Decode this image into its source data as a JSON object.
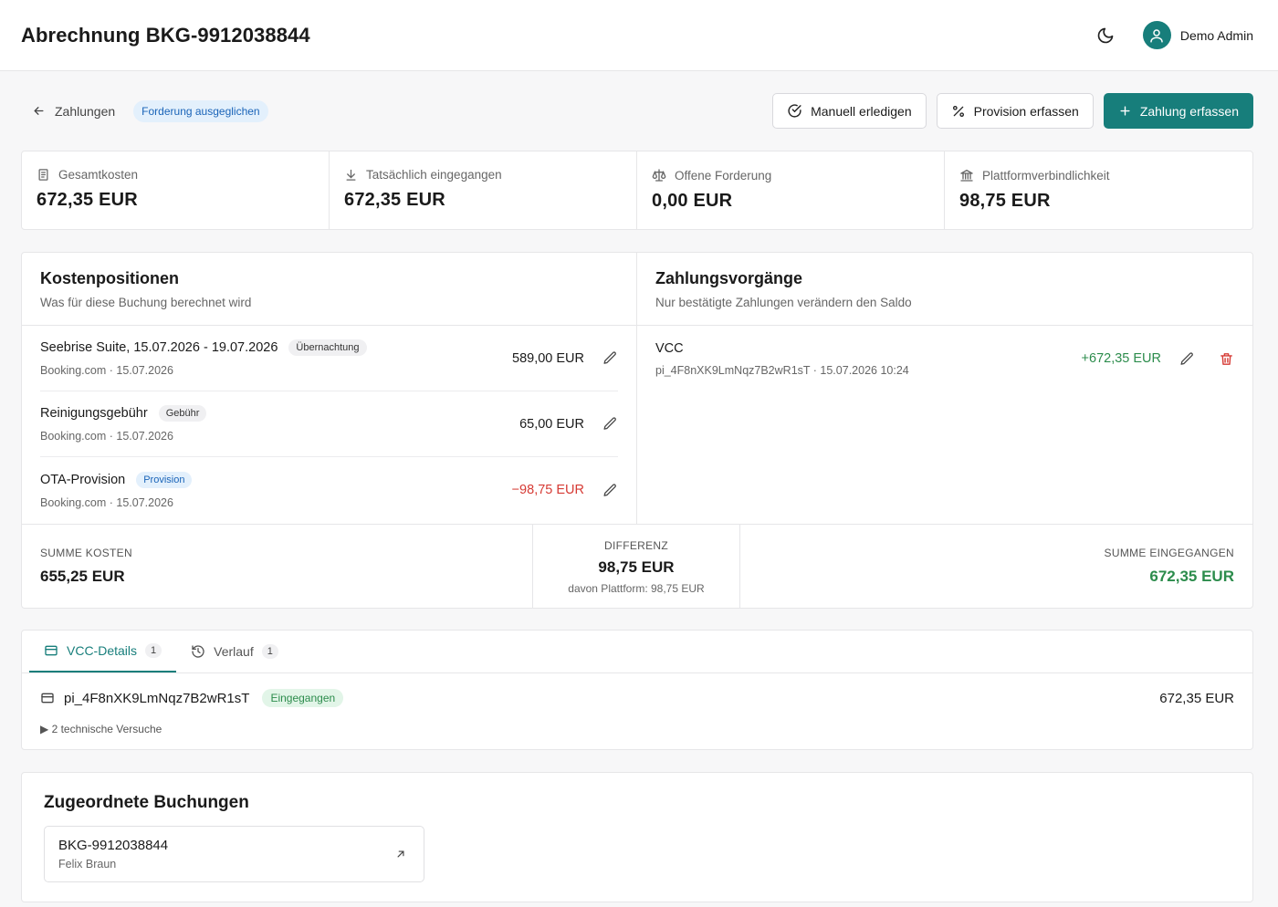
{
  "header": {
    "title": "Abrechnung BKG-9912038844",
    "user_name": "Demo Admin"
  },
  "toolbar": {
    "back_label": "Zahlungen",
    "status_badge": "Forderung ausgeglichen",
    "manual_label": "Manuell erledigen",
    "commission_label": "Provision erfassen",
    "payment_label": "Zahlung erfassen"
  },
  "stats": [
    {
      "label": "Gesamtkosten",
      "value": "672,35 EUR"
    },
    {
      "label": "Tatsächlich eingegangen",
      "value": "672,35 EUR"
    },
    {
      "label": "Offene Forderung",
      "value": "0,00 EUR"
    },
    {
      "label": "Plattformverbindlichkeit",
      "value": "98,75 EUR"
    }
  ],
  "costs": {
    "title": "Kostenpositionen",
    "subtitle": "Was für diese Buchung berechnet wird",
    "items": [
      {
        "name": "Seebrise Suite, 15.07.2026 - 19.07.2026",
        "tag": "Übernachtung",
        "meta": "Booking.com · 15.07.2026",
        "amount": "589,00 EUR"
      },
      {
        "name": "Reinigungsgebühr",
        "tag": "Gebühr",
        "meta": "Booking.com · 15.07.2026",
        "amount": "65,00 EUR"
      },
      {
        "name": "OTA-Provision",
        "tag": "Provision",
        "meta": "Booking.com · 15.07.2026",
        "amount": "−98,75 EUR"
      }
    ]
  },
  "payments": {
    "title": "Zahlungsvorgänge",
    "subtitle": "Nur bestätigte Zahlungen verändern den Saldo",
    "items": [
      {
        "method": "VCC",
        "meta": "pi_4F8nXK9LmNqz7B2wR1sT · 15.07.2026 10:24",
        "amount": "+672,35 EUR"
      }
    ]
  },
  "summary": {
    "costs_label": "SUMME KOSTEN",
    "costs_value": "655,25 EUR",
    "diff_label": "DIFFERENZ",
    "diff_value": "98,75 EUR",
    "diff_note": "davon Plattform: 98,75 EUR",
    "received_label": "SUMME EINGEGANGEN",
    "received_value": "672,35 EUR"
  },
  "tabs": [
    {
      "label": "VCC-Details",
      "count": "1"
    },
    {
      "label": "Verlauf",
      "count": "1"
    }
  ],
  "vcc": {
    "id": "pi_4F8nXK9LmNqz7B2wR1sT",
    "status": "Eingegangen",
    "amount": "672,35 EUR",
    "attempts": "▶ 2 technische Versuche"
  },
  "bookings": {
    "title": "Zugeordnete Buchungen",
    "items": [
      {
        "id": "BKG-9912038844",
        "guest": "Felix Braun"
      }
    ]
  },
  "colors": {
    "accent": "#177e7b",
    "negative": "#d63b35",
    "positive": "#2c8c4c",
    "badge_blue": "#1a64b8"
  }
}
